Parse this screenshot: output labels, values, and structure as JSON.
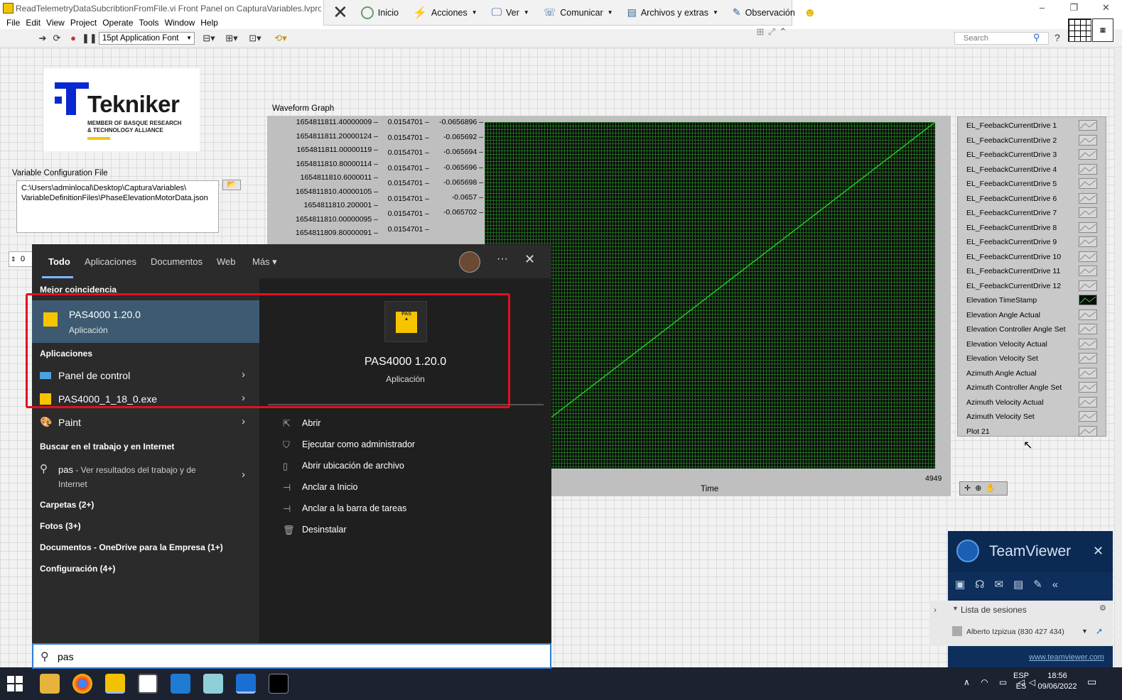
{
  "window": {
    "title": "ReadTelemetryDataSubcribtionFromFile.vi Front Panel on CapturaVariables.lvproj/My Co",
    "controls": [
      "–",
      "❐",
      "✕"
    ]
  },
  "teamviewer_toolbar": {
    "items": [
      {
        "label": "Inicio",
        "icon": "power-icon"
      },
      {
        "label": "Acciones",
        "icon": "lightning-icon"
      },
      {
        "label": "Ver",
        "icon": "monitor-icon"
      },
      {
        "label": "Comunicar",
        "icon": "phone-icon"
      },
      {
        "label": "Archivos y extras",
        "icon": "files-icon"
      },
      {
        "label": "Observación",
        "icon": "pen-icon"
      }
    ]
  },
  "menu": [
    "File",
    "Edit",
    "View",
    "Project",
    "Operate",
    "Tools",
    "Window",
    "Help"
  ],
  "toolbar": {
    "font": "15pt Application Font",
    "search_placeholder": "Search",
    "help": "?"
  },
  "logo": {
    "name": "Tekniker",
    "subtitle_line1": "MEMBER OF BASQUE RESEARCH",
    "subtitle_line2": "& TECHNOLOGY ALLIANCE"
  },
  "config": {
    "label": "Variable Configuration File",
    "path_line1": "C:\\Users\\adminlocal\\Desktop\\CapturaVariables\\",
    "path_line2": "VariableDefinitionFiles\\PhaseElevationMotorData.json",
    "number_value": "0"
  },
  "graph": {
    "label": "Waveform Graph",
    "x_title": "Time",
    "x_end": "4949",
    "y_col1": [
      "1654811811.40000009 –",
      "1654811811.20000124 –",
      "1654811811.00000119 –",
      "1654811810.80000114 –",
      "1654811810.6000011 –",
      "1654811810.40000105 –",
      "1654811810.200001 –",
      "1654811810.00000095 –",
      "1654811809.80000091 –"
    ],
    "y_col2": [
      "0.0154701 –",
      "0.0154701 –",
      "0.0154701 –",
      "0.0154701 –",
      "0.0154701 –",
      "0.0154701 –",
      "0.0154701 –",
      "0.0154701 –"
    ],
    "y_col3": [
      "-0.0656896 –",
      "-0.065692 –",
      "-0.065694 –",
      "-0.065696 –",
      "-0.065698 –",
      "-0.0657 –",
      "-0.065702 –"
    ],
    "line_color": "#22dd22"
  },
  "legend": [
    "EL_FeebackCurrentDrive 1",
    "EL_FeebackCurrentDrive 2",
    "EL_FeebackCurrentDrive 3",
    "EL_FeebackCurrentDrive 4",
    "EL_FeebackCurrentDrive 5",
    "EL_FeebackCurrentDrive 6",
    "EL_FeebackCurrentDrive 7",
    "EL_FeebackCurrentDrive 8",
    "EL_FeebackCurrentDrive 9",
    "EL_FeebackCurrentDrive 10",
    "EL_FeebackCurrentDrive 11",
    "EL_FeebackCurrentDrive 12",
    "Elevation TimeStamp",
    "Elevation Angle Actual",
    "Elevation Controller Angle Set",
    "Elevation Velocity Actual",
    "Elevation Velocity Set",
    "Azimuth Angle Actual",
    "Azimuth Controller Angle Set",
    "Azimuth Velocity Actual",
    "Azimuth Velocity Set",
    "Plot 21"
  ],
  "start_menu": {
    "tabs": [
      "Todo",
      "Aplicaciones",
      "Documentos",
      "Web",
      "Más ▾"
    ],
    "best_match_header": "Mejor coincidencia",
    "best_match": {
      "name": "PAS4000 1.20.0",
      "type": "Aplicación"
    },
    "apps_header": "Aplicaciones",
    "apps": [
      "Panel de control",
      "PAS4000_1_18_0.exe",
      "Paint"
    ],
    "web_header": "Buscar en el trabajo y en Internet",
    "web_query": "pas",
    "web_suffix": " - Ver resultados del trabajo y de",
    "web_suffix2": "Internet",
    "categories": [
      "Carpetas (2+)",
      "Fotos (3+)",
      "Documentos - OneDrive para la Empresa (1+)",
      "Configuración (4+)"
    ],
    "preview": {
      "name": "PAS4000 1.20.0",
      "type": "Aplicación",
      "icon_text": "PAS"
    },
    "actions": [
      "Abrir",
      "Ejecutar como administrador",
      "Abrir ubicación de archivo",
      "Anclar a Inicio",
      "Anclar a la barra de tareas",
      "Desinstalar"
    ],
    "search_value": "pas",
    "dots": "···",
    "close": "✕"
  },
  "teamviewer_panel": {
    "title": "TeamViewer",
    "sessions_title": "Lista de sesiones",
    "user": "Alberto Izpizua (830 427 434)",
    "link": "www.teamviewer.com"
  },
  "taskbar": {
    "lang1": "ESP",
    "lang2": "ES",
    "time": "18:56",
    "date": "09/06/2022"
  }
}
